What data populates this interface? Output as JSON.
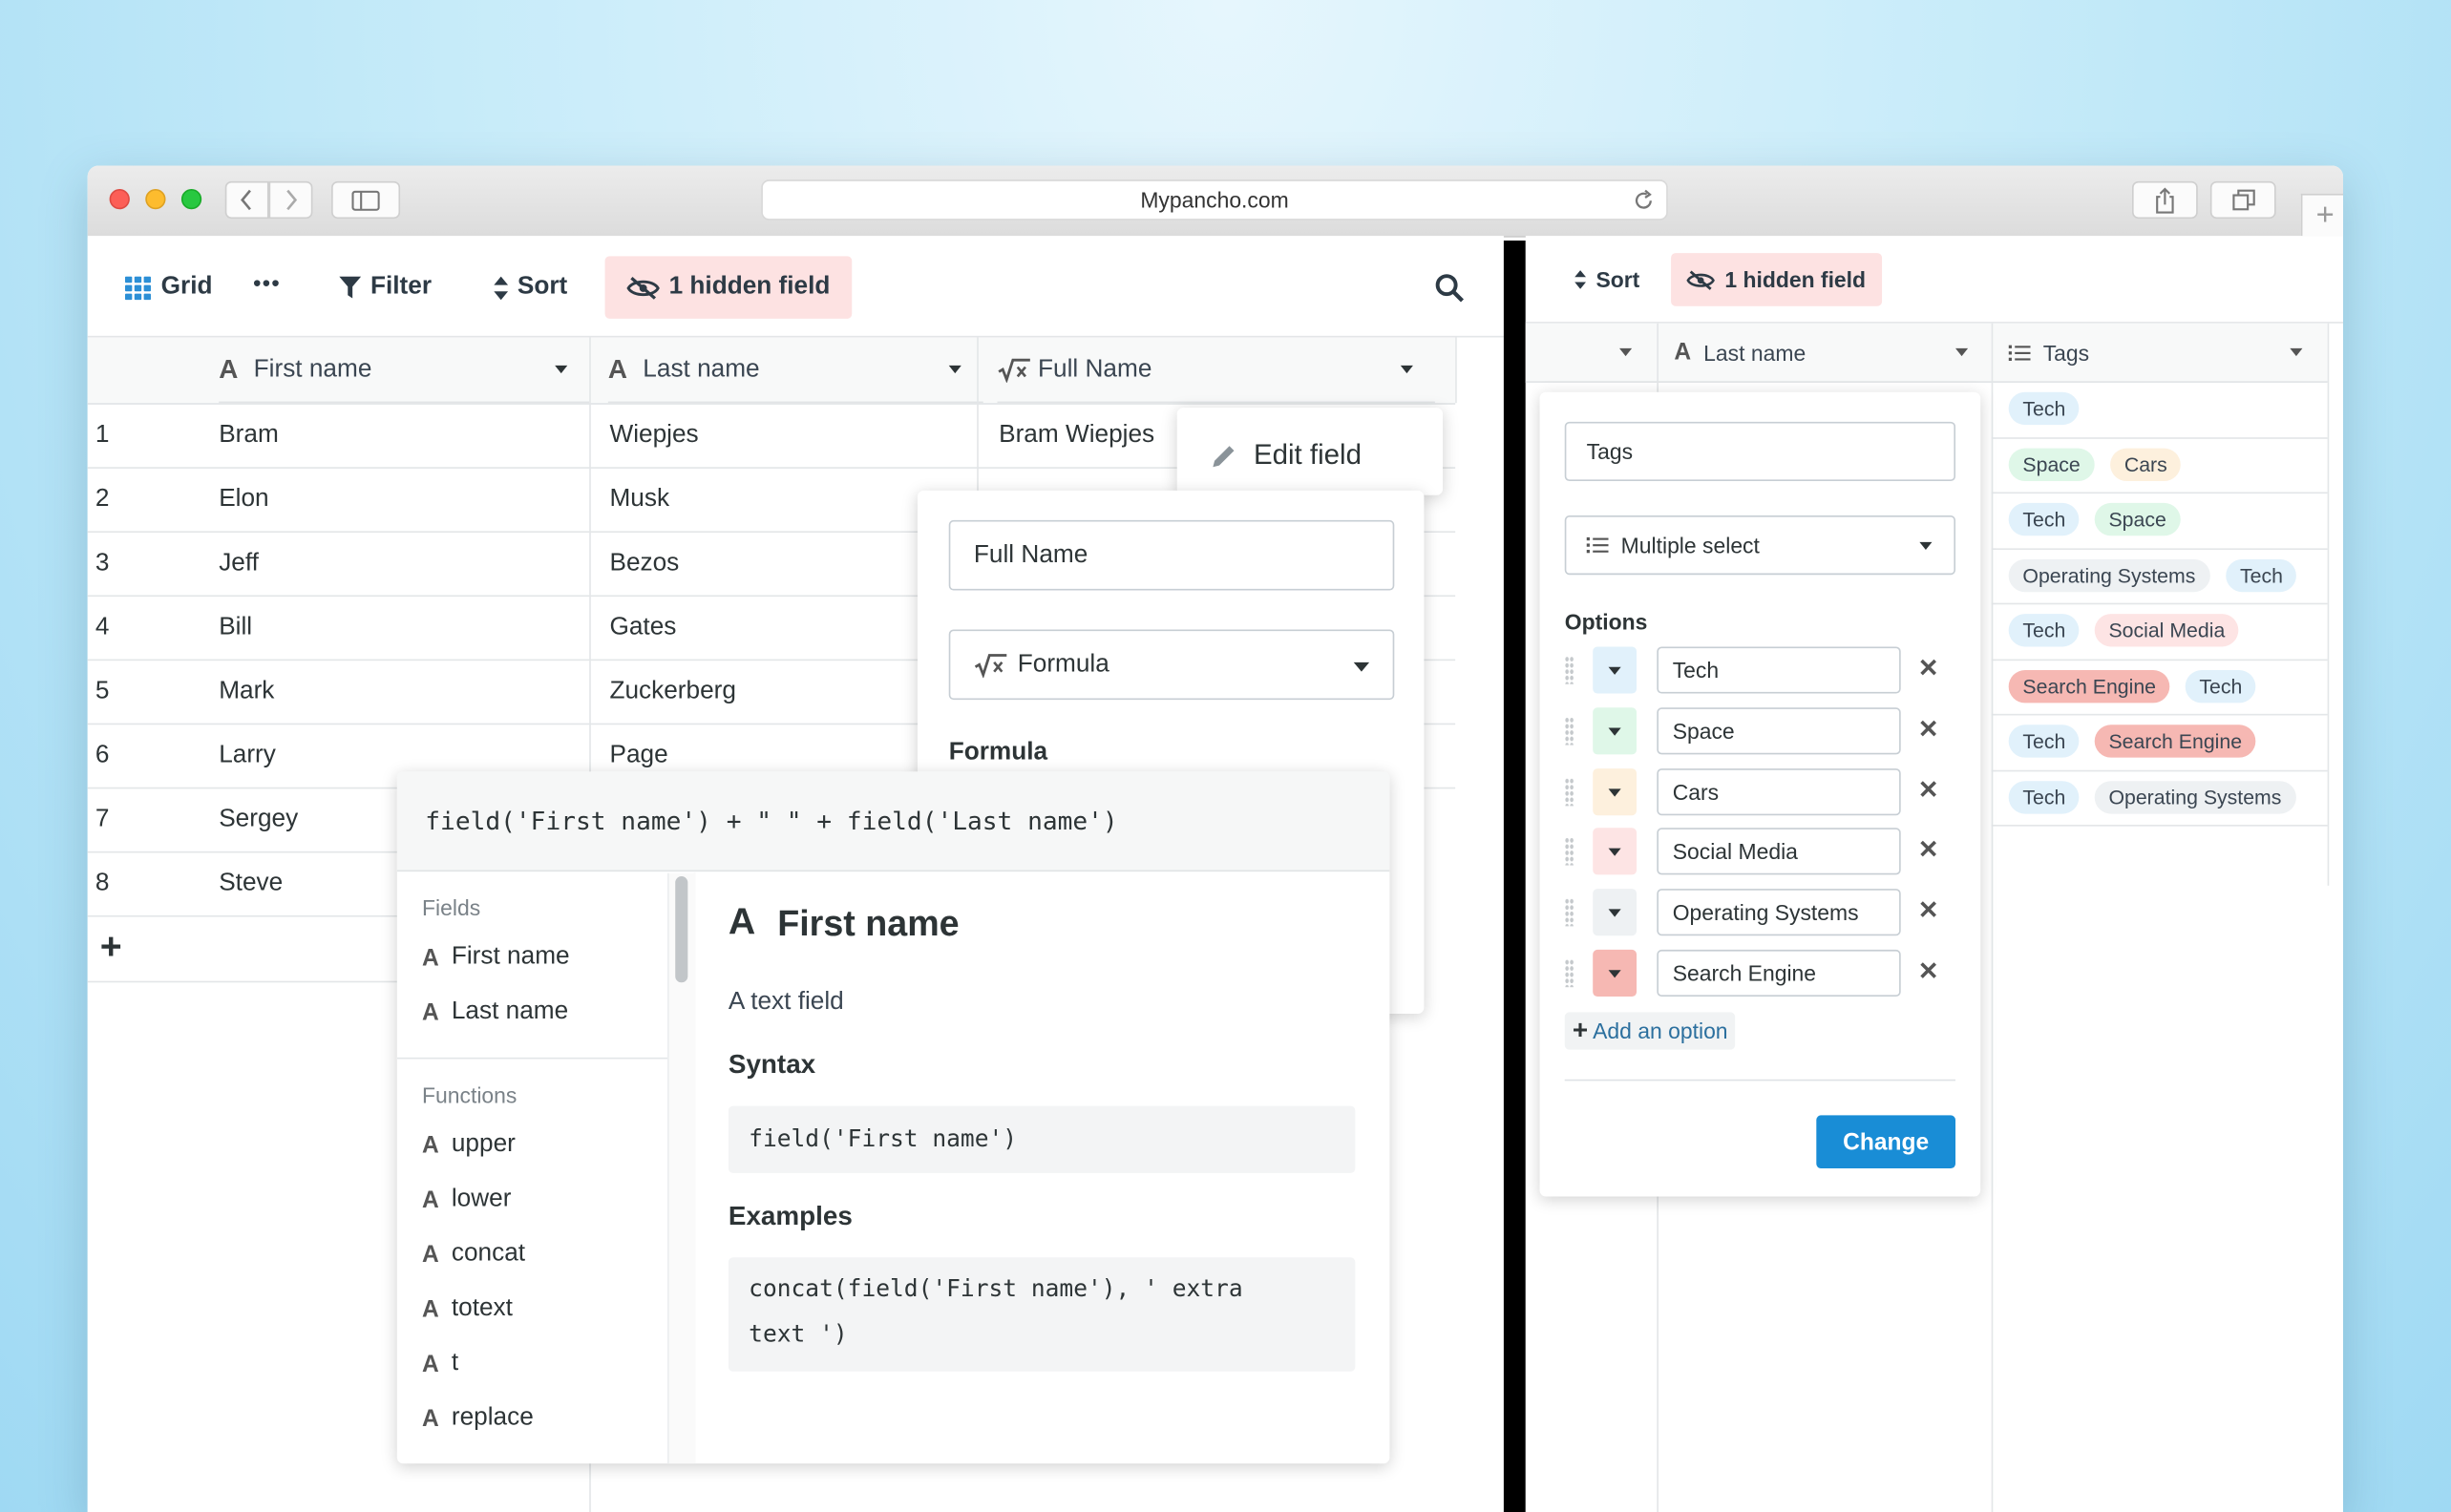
{
  "browser": {
    "url": "Mypancho.com"
  },
  "left_toolbar": {
    "grid_label": "Grid",
    "more_label": "•••",
    "filter_label": "Filter",
    "sort_label": "Sort",
    "hidden_field_label": "1 hidden field"
  },
  "left_table": {
    "columns": [
      "First name",
      "Last name",
      "Full Name"
    ],
    "rows": [
      {
        "id": "1",
        "first": "Bram",
        "last": "Wiepjes",
        "full": "Bram Wiepjes"
      },
      {
        "id": "2",
        "first": "Elon",
        "last": "Musk",
        "full": ""
      },
      {
        "id": "3",
        "first": "Jeff",
        "last": "Bezos",
        "full": ""
      },
      {
        "id": "4",
        "first": "Bill",
        "last": "Gates",
        "full": ""
      },
      {
        "id": "5",
        "first": "Mark",
        "last": "Zuckerberg",
        "full": ""
      },
      {
        "id": "6",
        "first": "Larry",
        "last": "Page",
        "full": ""
      },
      {
        "id": "7",
        "first": "Sergey",
        "last": "",
        "full": ""
      },
      {
        "id": "8",
        "first": "Steve",
        "last": "",
        "full": ""
      }
    ],
    "add_row": "+"
  },
  "edit_field_menu": {
    "label": "Edit field"
  },
  "field_form": {
    "name_value": "Full Name",
    "type_value": "Formula",
    "formula_label": "Formula"
  },
  "formula_editor": {
    "expression": "field('First name') + \" \" + field('Last name')",
    "fields_heading": "Fields",
    "fields": [
      "First name",
      "Last name"
    ],
    "functions_heading": "Functions",
    "functions": [
      "upper",
      "lower",
      "concat",
      "totext",
      "t",
      "replace"
    ],
    "detail": {
      "title": "First name",
      "description": "A text field",
      "syntax_heading": "Syntax",
      "syntax_code": "field('First name')",
      "examples_heading": "Examples",
      "example_line1": "concat(field('First name'), ' extra",
      "example_line2": "text ')"
    }
  },
  "right_toolbar": {
    "sort_label": "Sort",
    "hidden_field_label": "1 hidden field"
  },
  "right_table": {
    "columns": [
      "Last name",
      "Tags"
    ],
    "tag_rows": [
      [
        "Tech"
      ],
      [
        "Space",
        "Cars"
      ],
      [
        "Tech",
        "Space"
      ],
      [
        "Operating Systems",
        "Tech"
      ],
      [
        "Tech",
        "Social Media"
      ],
      [
        "Search Engine",
        "Tech"
      ],
      [
        "Tech",
        "Search Engine"
      ],
      [
        "Tech",
        "Operating Systems"
      ]
    ]
  },
  "tags_form": {
    "name_value": "Tags",
    "type_value": "Multiple select",
    "options_heading": "Options",
    "options": [
      {
        "label": "Tech",
        "color": "#e1f1fb"
      },
      {
        "label": "Space",
        "color": "#dff7e8"
      },
      {
        "label": "Cars",
        "color": "#fdf0dd"
      },
      {
        "label": "Social Media",
        "color": "#fde4e4"
      },
      {
        "label": "Operating Systems",
        "color": "#eef1f3"
      },
      {
        "label": "Search Engine",
        "color": "#f6b8b3"
      }
    ],
    "add_option_label": "Add an option",
    "submit_label": "Change"
  },
  "tag_colors": {
    "Tech": "#e1f1fb",
    "Space": "#dff7e8",
    "Cars": "#fdf0dd",
    "Social Media": "#fde4e4",
    "Operating Systems": "#eef1f3",
    "Search Engine": "#f6b8b3"
  },
  "colors": {
    "accent_blue": "#198dd6",
    "hidden_pill": "#fde2e2"
  }
}
